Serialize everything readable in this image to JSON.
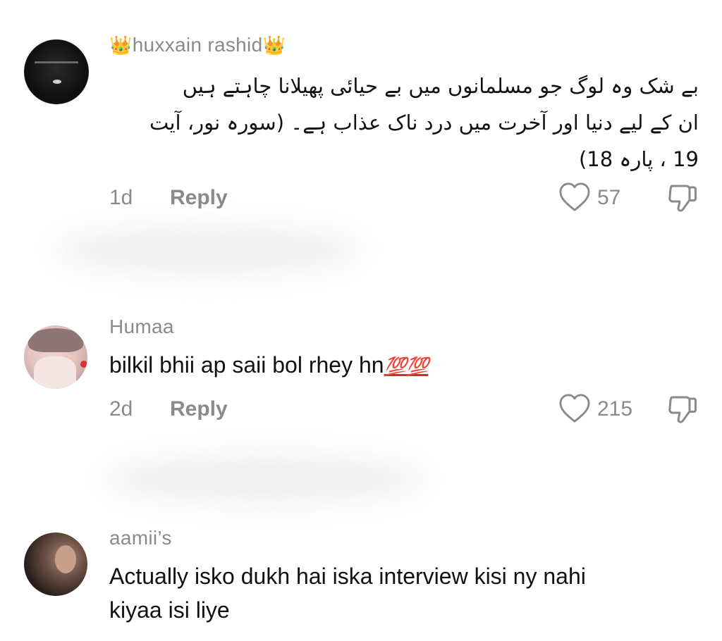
{
  "comments": [
    {
      "username": "huxxain rashid",
      "username_decoration": "👑",
      "text_line_1": "بے شک وہ لوگ جو مسلمانوں میں بے حیائی پھیلانا چاہتے ہیں",
      "text_line_2": "ان کے لیے دنیا اور آخرت میں درد ناک عذاب ہے۔ (سورہ نور، آیت",
      "text_line_3": "19 ، پارہ 18)",
      "time": "1d",
      "reply_label": "Reply",
      "likes": "57"
    },
    {
      "username": "Humaa",
      "text": "bilkil bhii ap saii bol rhey hn",
      "emoji": "💯💯",
      "time": "2d",
      "reply_label": "Reply",
      "likes": "215"
    },
    {
      "username": "aamii’s",
      "text_line_1": "Actually isko dukh hai iska interview kisi ny nahi",
      "text_line_2": "kiyaa isi liye"
    }
  ],
  "icons": {
    "like": "heart-outline-icon",
    "dislike": "thumbs-down-outline-icon"
  },
  "colors": {
    "text": "#111111",
    "muted": "#8a8a8a",
    "crown": "#e0b526",
    "emoji": "#d8262e"
  }
}
